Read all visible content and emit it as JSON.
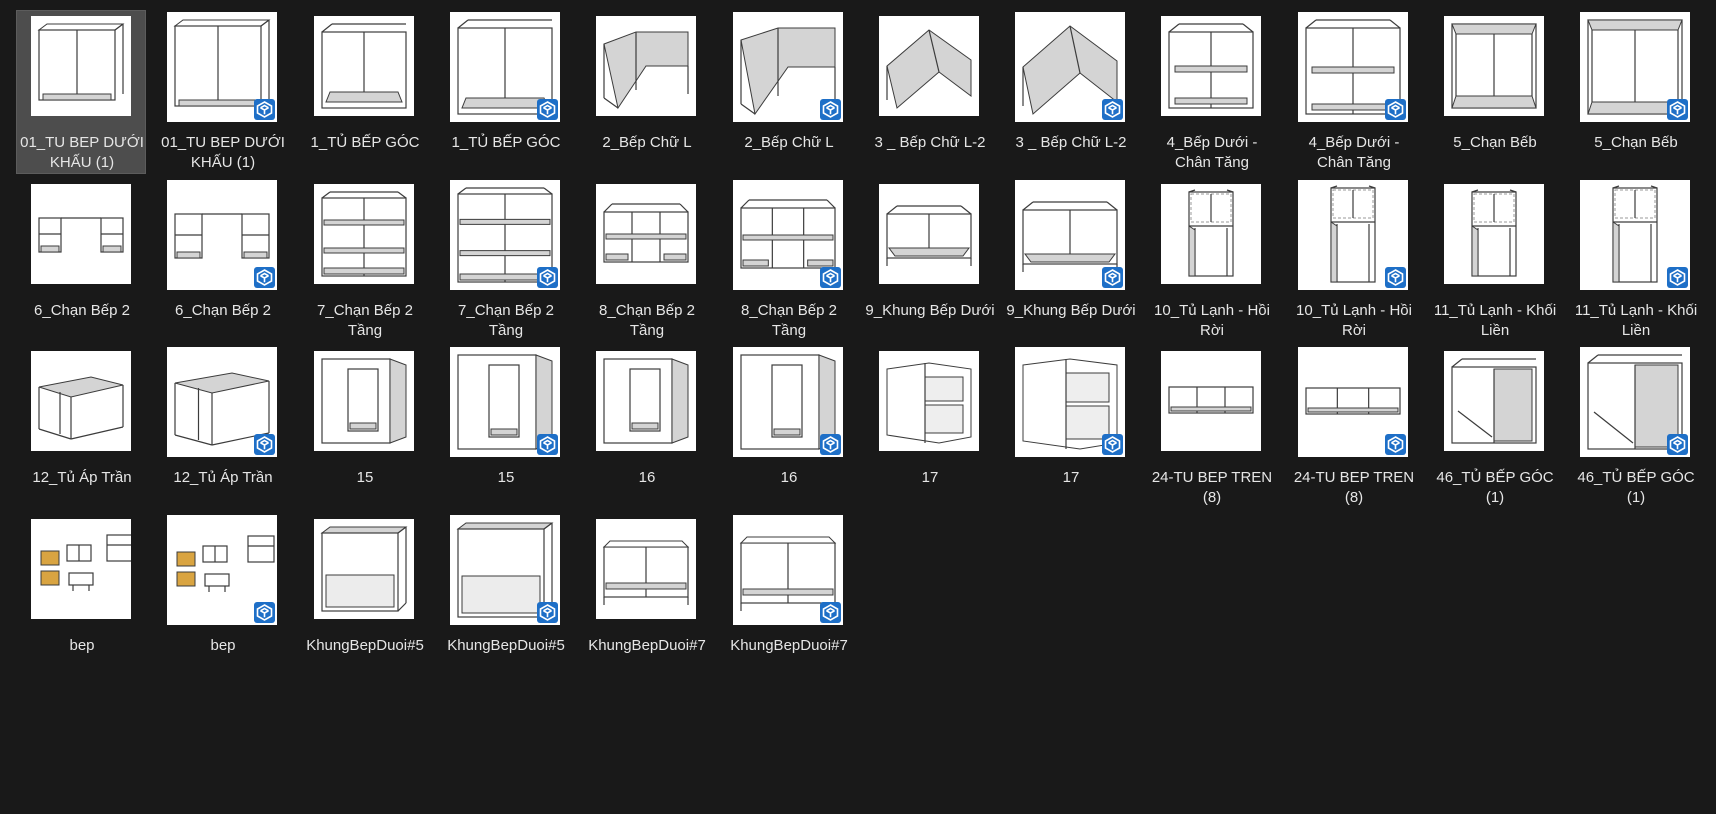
{
  "window": {
    "background": "#191919",
    "view": "Large icons"
  },
  "colors": {
    "thumb_bg": "#ffffff",
    "line": "#3c3c3c",
    "panel": "#d4d4d4",
    "wood": "#d9a441",
    "badge": "#1e6fc7"
  },
  "files": [
    {
      "name": "01_TU BEP DƯỚI KHẤU (1)",
      "kind": "preview",
      "model": "double",
      "selected": true
    },
    {
      "name": "01_TU BEP DƯỚI KHẤU (1)",
      "kind": "skp",
      "model": "double"
    },
    {
      "name": "1_TỦ BẾP GÓC",
      "kind": "preview",
      "model": "corner"
    },
    {
      "name": "1_TỦ BẾP GÓC",
      "kind": "skp",
      "model": "corner"
    },
    {
      "name": "2_Bếp Chữ L",
      "kind": "preview",
      "model": "lshape"
    },
    {
      "name": "2_Bếp Chữ L",
      "kind": "skp",
      "model": "lshape"
    },
    {
      "name": "3 _ Bếp Chữ L-2",
      "kind": "preview",
      "model": "lshape2"
    },
    {
      "name": "3 _ Bếp Chữ L-2",
      "kind": "skp",
      "model": "lshape2"
    },
    {
      "name": "4_Bếp Dưới - Chân Tăng",
      "kind": "preview",
      "model": "shelf2"
    },
    {
      "name": "4_Bếp Dưới - Chân Tăng",
      "kind": "skp",
      "model": "shelf2"
    },
    {
      "name": "5_Chạn Bếb",
      "kind": "preview",
      "model": "tall2"
    },
    {
      "name": "5_Chạn Bếb",
      "kind": "skp",
      "model": "tall2"
    },
    {
      "name": "6_Chạn Bếp 2",
      "kind": "preview",
      "model": "cube3"
    },
    {
      "name": "6_Chạn Bếp 2",
      "kind": "skp",
      "model": "cube3"
    },
    {
      "name": "7_Chạn Bếp 2 Tầng",
      "kind": "preview",
      "model": "grid4"
    },
    {
      "name": "7_Chạn Bếp 2 Tầng",
      "kind": "skp",
      "model": "grid4"
    },
    {
      "name": "8_Chạn Bếp 2 Tầng",
      "kind": "preview",
      "model": "wide6"
    },
    {
      "name": "8_Chạn Bếp 2 Tầng",
      "kind": "skp",
      "model": "wide6"
    },
    {
      "name": "9_Khung Bếp Dưới",
      "kind": "preview",
      "model": "frame"
    },
    {
      "name": "9_Khung Bếp Dưới",
      "kind": "skp",
      "model": "frame"
    },
    {
      "name": "10_Tủ Lạnh - Hồi Rời",
      "kind": "preview",
      "model": "fridge"
    },
    {
      "name": "10_Tủ Lạnh - Hồi Rời",
      "kind": "skp",
      "model": "fridge"
    },
    {
      "name": "11_Tủ Lạnh - Khối Liền",
      "kind": "preview",
      "model": "fridge2"
    },
    {
      "name": "11_Tủ Lạnh - Khối Liền",
      "kind": "skp",
      "model": "fridge2"
    },
    {
      "name": "12_Tủ Áp Trần",
      "kind": "preview",
      "model": "ceiling"
    },
    {
      "name": "12_Tủ Áp Trần",
      "kind": "skp",
      "model": "ceiling"
    },
    {
      "name": "15",
      "kind": "preview",
      "model": "door"
    },
    {
      "name": "15",
      "kind": "skp",
      "model": "door"
    },
    {
      "name": "16",
      "kind": "preview",
      "model": "door2"
    },
    {
      "name": "16",
      "kind": "skp",
      "model": "door2"
    },
    {
      "name": "17",
      "kind": "preview",
      "model": "cornershelf"
    },
    {
      "name": "17",
      "kind": "skp",
      "model": "cornershelf"
    },
    {
      "name": "24-TU BEP TREN (8)",
      "kind": "preview",
      "model": "low"
    },
    {
      "name": "24-TU BEP TREN (8)",
      "kind": "skp",
      "model": "low"
    },
    {
      "name": "46_TỦ BẾP GÓC (1)",
      "kind": "preview",
      "model": "corner46"
    },
    {
      "name": "46_TỦ BẾP GÓC (1)",
      "kind": "skp",
      "model": "corner46"
    },
    {
      "name": "bep",
      "kind": "preview",
      "model": "bep"
    },
    {
      "name": "bep",
      "kind": "skp",
      "model": "bep"
    },
    {
      "name": "KhungBepDuoi#5",
      "kind": "preview",
      "model": "box"
    },
    {
      "name": "KhungBepDuoi#5",
      "kind": "skp",
      "model": "box"
    },
    {
      "name": "KhungBepDuoi#7",
      "kind": "preview",
      "model": "frame2"
    },
    {
      "name": "KhungBepDuoi#7",
      "kind": "skp",
      "model": "frame2"
    }
  ]
}
